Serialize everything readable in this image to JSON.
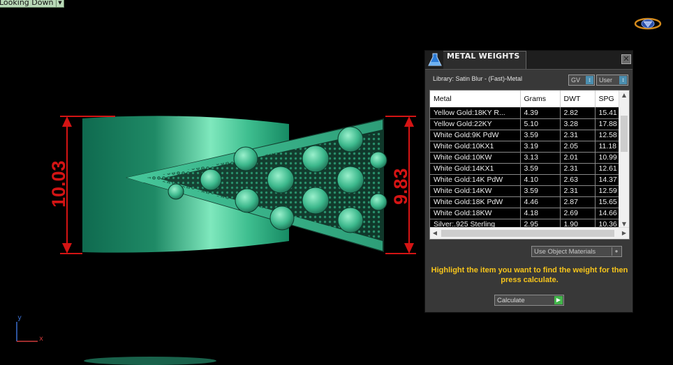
{
  "viewport": {
    "view_mode": "Looking Down",
    "dimension_left": "10.03",
    "dimension_right": "9.83",
    "axis_x_label": "x",
    "axis_y_label": "y",
    "colors": {
      "background": "#000000",
      "model_green": "#2fae86",
      "dimension_red": "#d41414"
    }
  },
  "panel": {
    "title": "METAL WEIGHTS",
    "close_icon": "close-icon",
    "library_text": "Library: Satin Blur - (Fast)-Metal",
    "gv_select": "GV",
    "user_select": "User",
    "columns": [
      "Metal",
      "Grams",
      "DWT",
      "SPG"
    ],
    "rows": [
      [
        "Yellow Gold:18KY R...",
        "4.39",
        "2.82",
        "15.41"
      ],
      [
        "Yellow Gold:22KY",
        "5.10",
        "3.28",
        "17.88"
      ],
      [
        "White Gold:9K PdW",
        "3.59",
        "2.31",
        "12.58"
      ],
      [
        "White Gold:10KX1",
        "3.19",
        "2.05",
        "11.18"
      ],
      [
        "White Gold:10KW",
        "3.13",
        "2.01",
        "10.99"
      ],
      [
        "White Gold:14KX1",
        "3.59",
        "2.31",
        "12.61"
      ],
      [
        "White Gold:14K PdW",
        "4.10",
        "2.63",
        "14.37"
      ],
      [
        "White Gold:14KW",
        "3.59",
        "2.31",
        "12.59"
      ],
      [
        "White Gold:18K PdW",
        "4.46",
        "2.87",
        "15.65"
      ],
      [
        "White Gold:18KW",
        "4.18",
        "2.69",
        "14.66"
      ],
      [
        "Silver:.925 Sterling",
        "2.95",
        "1.90",
        "10.36"
      ]
    ],
    "use_object_materials": "Use Object Materials",
    "instruction": "Highlight the item you want to find the weight for then press calculate.",
    "calculate_label": "Calculate",
    "colors": {
      "panel_bg": "#383838",
      "instruction_text": "#f7c51b",
      "calculate_go": "#42b54a"
    }
  }
}
